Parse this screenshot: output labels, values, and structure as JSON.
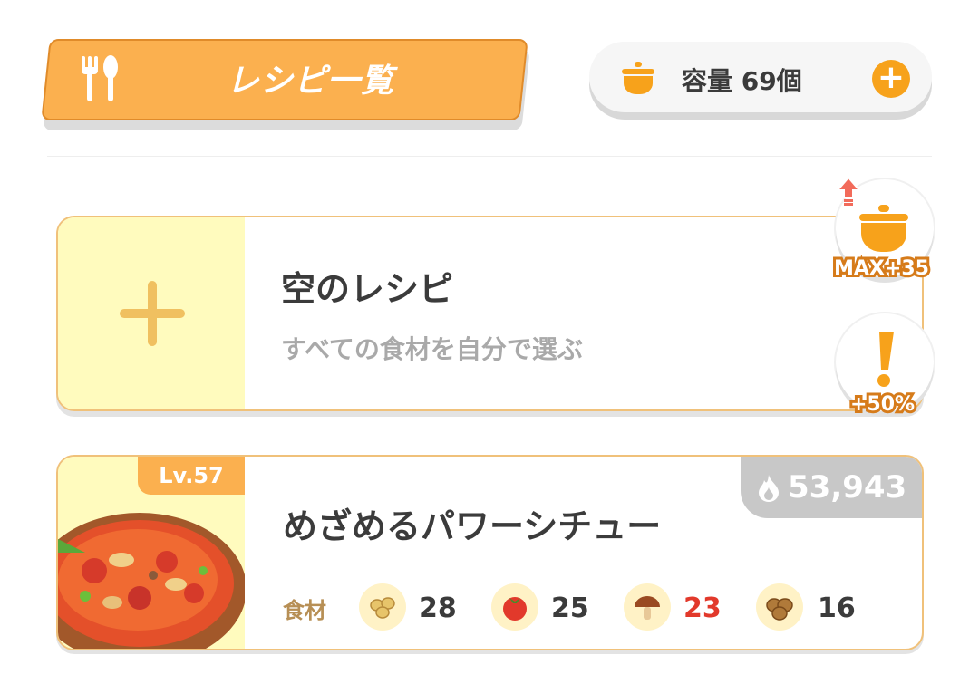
{
  "header": {
    "title": "レシピ一覧",
    "capacity_text": "容量 69個"
  },
  "side_badges": {
    "pot_bonus": "MAX+35",
    "exclaim_bonus": "+50%"
  },
  "empty_recipe": {
    "title": "空のレシピ",
    "subtitle": "すべての食材を自分で選ぶ"
  },
  "recipe": {
    "level": "Lv.57",
    "energy": "53,943",
    "title": "めざめるパワーシチュー",
    "ingredients_label": "食材",
    "ingredients": [
      {
        "icon": "soybeans-icon",
        "count": "28"
      },
      {
        "icon": "tomato-icon",
        "count": "25"
      },
      {
        "icon": "mushroom-icon",
        "count": "23",
        "highlight": true
      },
      {
        "icon": "potato-icon",
        "count": "16"
      }
    ]
  },
  "colors": {
    "accent": "#fbb04f",
    "plus": "#f7a21b",
    "warning": "#e2392b",
    "card_border": "#f0c17a"
  }
}
